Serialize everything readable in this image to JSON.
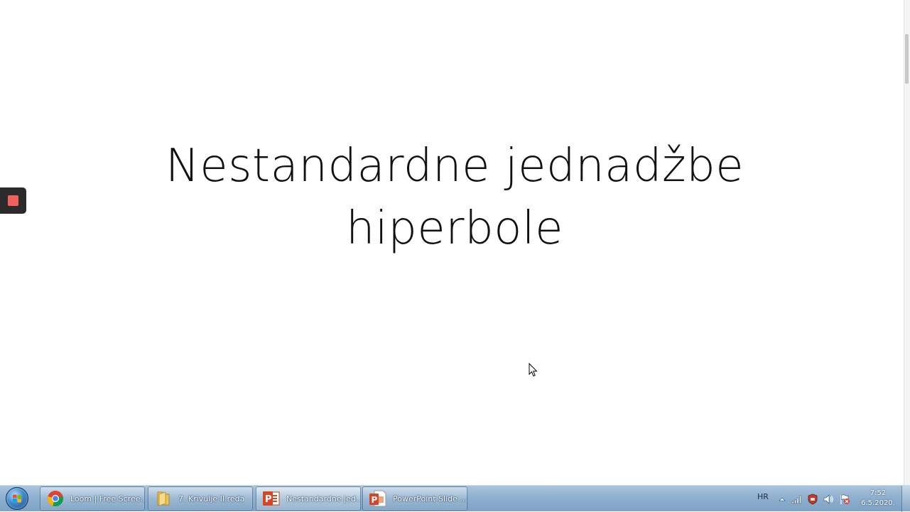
{
  "slide": {
    "title_line1": "Nestandardne jednadžbe",
    "title_line2": "hiperbole"
  },
  "recorder": {
    "icon": "stop-recording-icon",
    "stop_color": "#f0605d"
  },
  "taskbar": {
    "start_icon": "windows-start-orb-icon",
    "items": [
      {
        "label": "Loom | Free Scree...",
        "icon": "chrome-icon",
        "active": false
      },
      {
        "label": "7. Krivulje II.reda",
        "icon": "folder-icon",
        "active": false
      },
      {
        "label": "Nestandardne jed...",
        "icon": "powerpoint-icon",
        "active": true
      },
      {
        "label": "PowerPoint Slide ...",
        "icon": "powerpoint-slideshow-icon",
        "active": false
      }
    ],
    "tray": {
      "language": "HR",
      "icons": [
        "show-hidden-icons-arrow",
        "network-icon",
        "shield-icon",
        "volume-icon",
        "action-center-flag-icon"
      ],
      "time": "7:52",
      "date": "6.5.2020."
    }
  }
}
